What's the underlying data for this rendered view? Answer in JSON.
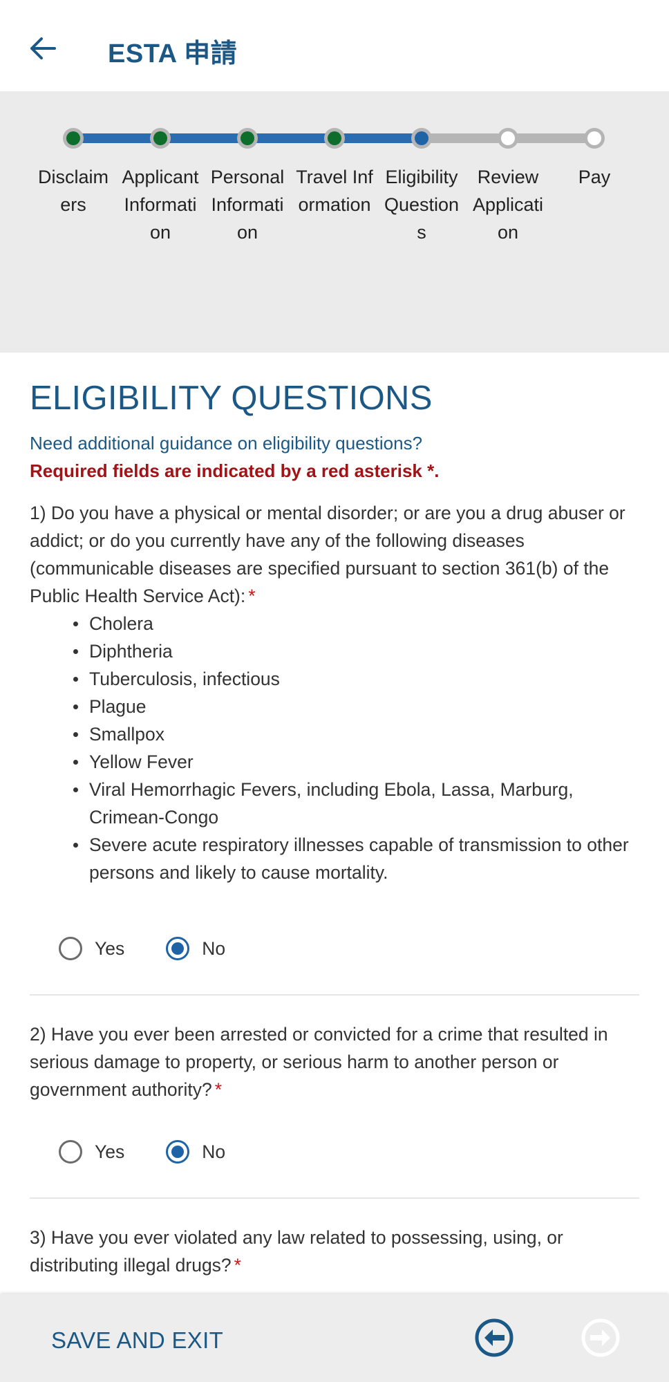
{
  "header": {
    "title": "ESTA 申請"
  },
  "stepper": {
    "steps": [
      {
        "label": "Disclaimers",
        "status": "complete"
      },
      {
        "label": "Applicant Information",
        "status": "complete"
      },
      {
        "label": "Personal Information",
        "status": "complete"
      },
      {
        "label": "Travel Information",
        "status": "complete"
      },
      {
        "label": "Eligibility Questions",
        "status": "current"
      },
      {
        "label": "Review Application",
        "status": "upcoming"
      },
      {
        "label": "Pay",
        "status": "upcoming"
      }
    ],
    "colors": {
      "complete": "#0c6e2a",
      "current": "#1e63a6",
      "upcoming": "#ffffff",
      "track_done": "#2b6cb0",
      "track_todo": "#b5b5b5"
    }
  },
  "main": {
    "title": "ELIGIBILITY QUESTIONS",
    "guidance_link": "Need additional guidance on eligibility questions?",
    "required_note": "Required fields are indicated by a red asterisk *.",
    "questions": [
      {
        "text": "1) Do you have a physical or mental disorder; or are you a drug abuser or addict; or do you currently have any of the following diseases (communicable diseases are specified pursuant to section 361(b) of the Public Health Service Act):",
        "asterisk": "*",
        "list": [
          "Cholera",
          "Diphtheria",
          "Tuberculosis, infectious",
          "Plague",
          "Smallpox",
          "Yellow Fever",
          "Viral Hemorrhagic Fevers, including Ebola, Lassa, Marburg, Crimean-Congo",
          "Severe acute respiratory illnesses capable of transmission to other persons and likely to cause mortality."
        ],
        "yes_label": "Yes",
        "no_label": "No",
        "selected": "No"
      },
      {
        "text": "2) Have you ever been arrested or convicted for a crime that resulted in serious damage to property, or serious harm to another person or government authority?",
        "asterisk": "*",
        "yes_label": "Yes",
        "no_label": "No",
        "selected": "No"
      },
      {
        "text": "3) Have you ever violated any law related to possessing, using, or distributing illegal drugs?",
        "asterisk": "*"
      }
    ]
  },
  "footer": {
    "save_exit": "SAVE AND EXIT",
    "prev_icon": "arrow-left-circle-icon",
    "next_icon": "arrow-right-circle-icon",
    "next_enabled": false
  },
  "colors": {
    "brand_blue": "#1b5885",
    "required_red": "#a11316"
  }
}
